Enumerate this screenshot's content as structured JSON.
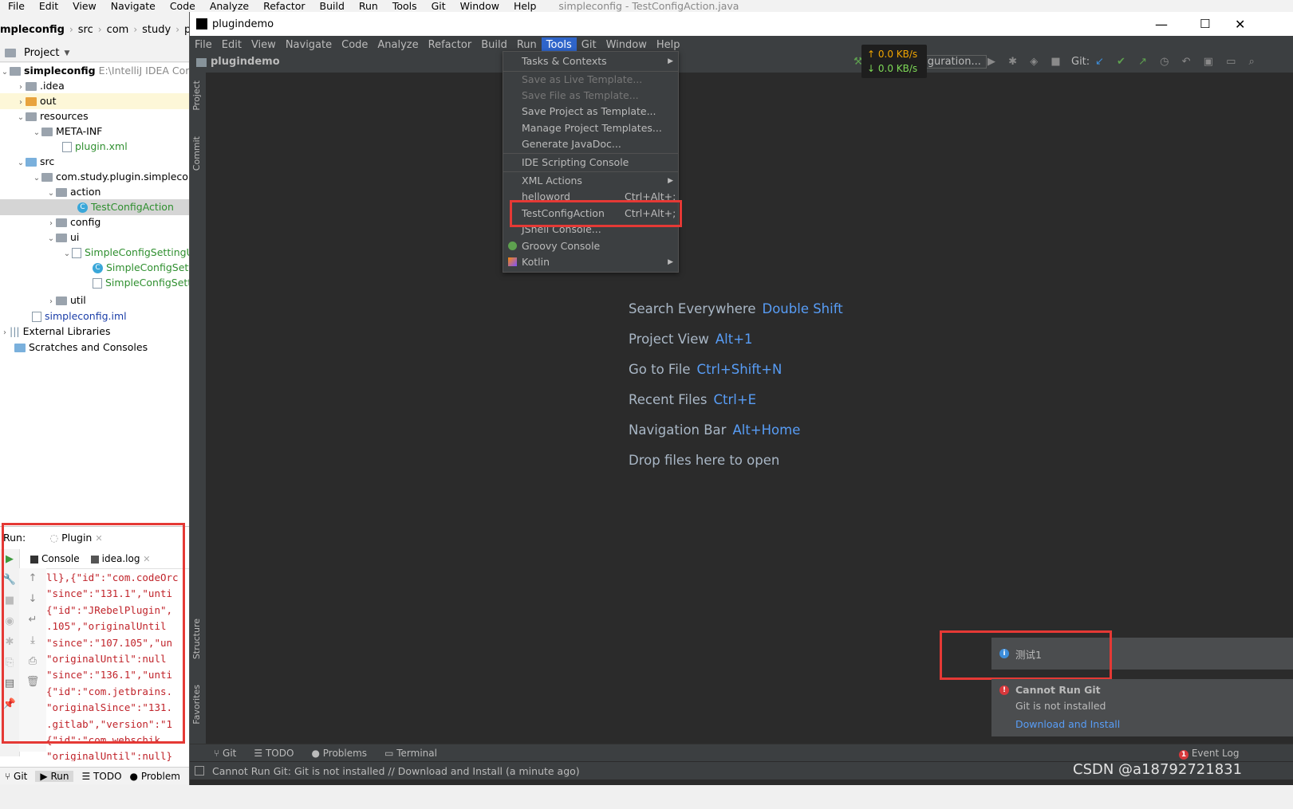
{
  "bg_ide": {
    "menu": [
      "File",
      "Edit",
      "View",
      "Navigate",
      "Code",
      "Analyze",
      "Refactor",
      "Build",
      "Run",
      "Tools",
      "Git",
      "Window",
      "Help"
    ],
    "title": "simpleconfig - TestConfigAction.java",
    "breadcrumb": [
      "mpleconfig",
      "src",
      "com",
      "study",
      "plugin"
    ],
    "project_header": "Project",
    "tree": [
      {
        "label": "simpleconfig",
        "extra": "E:\\IntelliJ IDEA Comm"
      },
      {
        "label": ".idea"
      },
      {
        "label": "out"
      },
      {
        "label": "resources"
      },
      {
        "label": "META-INF"
      },
      {
        "label": "plugin.xml"
      },
      {
        "label": "src"
      },
      {
        "label": "com.study.plugin.simpleconfi"
      },
      {
        "label": "action"
      },
      {
        "label": "TestConfigAction"
      },
      {
        "label": "config"
      },
      {
        "label": "ui"
      },
      {
        "label": "SimpleConfigSettingU"
      },
      {
        "label": "SimpleConfigSettin"
      },
      {
        "label": "SimpleConfigSettin"
      },
      {
        "label": "util"
      },
      {
        "label": "simpleconfig.iml"
      },
      {
        "label": "External Libraries"
      },
      {
        "label": "Scratches and Consoles"
      }
    ],
    "run": {
      "label": "Run:",
      "tab": "Plugin",
      "subtabs": [
        "Console",
        "idea.log"
      ],
      "console_lines": [
        "ll},{\"id\":\"com.codeOrc",
        "\"since\":\"131.1\",\"unti",
        "{\"id\":\"JRebelPlugin\",",
        ".105\",\"originalUntil",
        "\"since\":\"107.105\",\"un",
        "\"originalUntil\":null",
        "\"since\":\"136.1\",\"unti",
        "{\"id\":\"com.jetbrains.",
        "\"originalSince\":\"131.",
        ".gitlab\",\"version\":\"1",
        "{\"id\":\"com.webschik.",
        "\"originalUntil\":null}"
      ]
    },
    "bottom_tabs": [
      "Git",
      "Run",
      "TODO",
      "Problem"
    ]
  },
  "dark_ide": {
    "window_title": "plugindemo",
    "menu": [
      "File",
      "Edit",
      "View",
      "Navigate",
      "Code",
      "Analyze",
      "Refactor",
      "Build",
      "Run",
      "Tools",
      "Git",
      "Window",
      "Help"
    ],
    "active_menu": "Tools",
    "project_name": "plugindemo",
    "run_config": "Add Configuration...",
    "git_label": "Git:",
    "sidebar_tabs": [
      "Project",
      "Commit",
      "Structure",
      "Favorites"
    ],
    "tools_menu": [
      {
        "label": "Tasks & Contexts",
        "submenu": true,
        "disabled": false
      },
      {
        "label": "Save as Live Template...",
        "disabled": true
      },
      {
        "label": "Save File as Template...",
        "disabled": true
      },
      {
        "label": "Save Project as Template...",
        "disabled": false
      },
      {
        "label": "Manage Project Templates...",
        "disabled": false
      },
      {
        "label": "Generate JavaDoc...",
        "disabled": false
      },
      {
        "label": "IDE Scripting Console",
        "disabled": false
      },
      {
        "label": "XML Actions",
        "submenu": true,
        "disabled": false
      },
      {
        "label": "helloword",
        "shortcut": "Ctrl+Alt+;",
        "disabled": false
      },
      {
        "label": "TestConfigAction",
        "shortcut": "Ctrl+Alt+;",
        "disabled": false
      },
      {
        "label": "JShell Console...",
        "disabled": false
      },
      {
        "label": "Groovy Console",
        "disabled": false
      },
      {
        "label": "Kotlin",
        "submenu": true,
        "disabled": false
      }
    ],
    "hints": [
      {
        "text": "Search Everywhere",
        "key": "Double Shift"
      },
      {
        "text": "Project View",
        "key": "Alt+1"
      },
      {
        "text": "Go to File",
        "key": "Ctrl+Shift+N"
      },
      {
        "text": "Recent Files",
        "key": "Ctrl+E"
      },
      {
        "text": "Navigation Bar",
        "key": "Alt+Home"
      },
      {
        "text": "Drop files here to open",
        "key": ""
      }
    ],
    "net": {
      "up": "↑ 0.0 KB/s",
      "down": "↓ 0.0 KB/s"
    },
    "notifications": {
      "info": "测试1",
      "error_title": "Cannot Run Git",
      "error_body": "Git is not installed",
      "error_link": "Download and Install"
    },
    "bottom_tabs": [
      "Git",
      "TODO",
      "Problems",
      "Terminal"
    ],
    "event_log": "Event Log",
    "status": "Cannot Run Git: Git is not installed // Download and Install (a minute ago)"
  },
  "watermark": "CSDN @a18792721831",
  "colors": {
    "accent": "#2f65ca",
    "highlight_box": "#e53935",
    "hint_key": "#589df6"
  }
}
